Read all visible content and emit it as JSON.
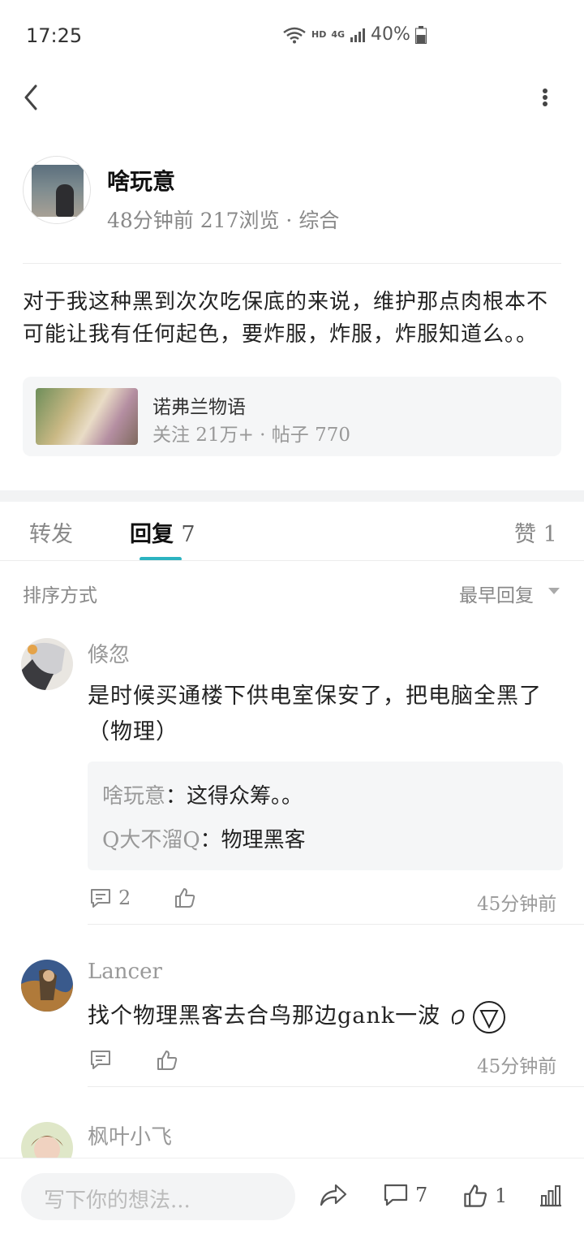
{
  "status_bar": {
    "time": "17:25",
    "net_hd": "HD",
    "net_4g": "4G",
    "battery": "40%"
  },
  "post": {
    "author": "啥玩意",
    "meta": "48分钟前 217浏览 · 综合",
    "body": "对于我这种黑到次次吃保底的来说，维护那点肉根本不可能让我有任何起色，要炸服，炸服，炸服知道么。。",
    "forum": {
      "name": "诺弗兰物语",
      "meta": "关注 21万+ · 帖子 770"
    }
  },
  "tabs": {
    "share": "转发",
    "reply": "回复",
    "reply_count": "7",
    "like": "赞 1"
  },
  "sort": {
    "label": "排序方式",
    "value": "最早回复"
  },
  "comments": [
    {
      "name": "倏忽",
      "text": "是时候买通楼下供电室保安了，把电脑全黑了（物理）",
      "replies": [
        {
          "name": "啥玩意",
          "text": "：这得众筹。。"
        },
        {
          "name": "Q大不溜Q",
          "text": "：物理黑客"
        }
      ],
      "reply_count": "2",
      "time": "45分钟前"
    },
    {
      "name": "Lancer",
      "text": "找个物理黑客去合鸟那边gank一波",
      "reply_count": "",
      "time": "45分钟前"
    },
    {
      "name": "枫叶小飞"
    }
  ],
  "bottom_bar": {
    "placeholder": "写下你的想法...",
    "comment_count": "7",
    "like_count": "1"
  }
}
